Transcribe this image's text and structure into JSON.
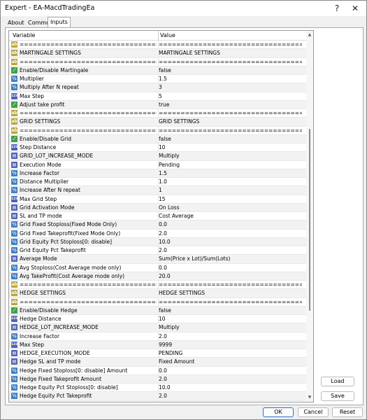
{
  "window": {
    "title": "Expert - EA-MacdTradingEa"
  },
  "titlebar": {
    "help_icon": "?",
    "close_icon": "✕"
  },
  "tabs": [
    {
      "label": "About"
    },
    {
      "label": "Common"
    },
    {
      "label": "Inputs"
    }
  ],
  "active_tab": "Inputs",
  "grid": {
    "col_variable": "Variable",
    "col_value": "Value",
    "rows": [
      {
        "icon": "ab",
        "name": "=================================================",
        "value": "================================================="
      },
      {
        "icon": "ab",
        "name": "MARTINGALE SETTINGS",
        "value": "MARTINGALE SETTINGS"
      },
      {
        "icon": "ab",
        "name": "=================================================",
        "value": "================================================="
      },
      {
        "icon": "bool",
        "name": "Enable/Disable Martingale",
        "value": "false"
      },
      {
        "icon": "val",
        "name": "Multiplier",
        "value": "1.5"
      },
      {
        "icon": "val",
        "name": "Multiply After N repeat",
        "value": "3"
      },
      {
        "icon": "int",
        "name": "Max Step",
        "value": "5"
      },
      {
        "icon": "bool",
        "name": "Adjust take profit",
        "value": "true"
      },
      {
        "icon": "ab",
        "name": "=================================================",
        "value": "================================================="
      },
      {
        "icon": "ab",
        "name": "GRID SETTINGS",
        "value": "GRID SETTINGS"
      },
      {
        "icon": "ab",
        "name": "=================================================",
        "value": "================================================="
      },
      {
        "icon": "bool",
        "name": "Enable/Disable Grid",
        "value": "false"
      },
      {
        "icon": "int",
        "name": "Step Distance",
        "value": "10"
      },
      {
        "icon": "en",
        "name": "GRID_LOT_INCREASE_MODE",
        "value": "Multiply"
      },
      {
        "icon": "en",
        "name": "Execution Mode",
        "value": "Pending"
      },
      {
        "icon": "val",
        "name": "Increase Factor",
        "value": "1.5"
      },
      {
        "icon": "val",
        "name": "Distance Multiplier",
        "value": "1.0"
      },
      {
        "icon": "val",
        "name": "Increase After N repeat",
        "value": "1"
      },
      {
        "icon": "int",
        "name": "Max Grid Step",
        "value": "15"
      },
      {
        "icon": "en",
        "name": "Grid Activation Mode",
        "value": "On Loss"
      },
      {
        "icon": "en",
        "name": "SL and TP mode",
        "value": "Cost Average"
      },
      {
        "icon": "val",
        "name": "Grid Fixed Stoploss(Fixed Mode Only)",
        "value": "0.0"
      },
      {
        "icon": "val",
        "name": "Grid Fixed Takeprofit(Fixed Mode Only)",
        "value": "2.0"
      },
      {
        "icon": "val",
        "name": "Grid Equity Pct Stoploss[0: disable]",
        "value": "10.0"
      },
      {
        "icon": "val",
        "name": "Grid Equity Pct Takeprofit",
        "value": "2.0"
      },
      {
        "icon": "en",
        "name": "Average Mode",
        "value": "Sum(Price x Lot)/Sum(Lots)"
      },
      {
        "icon": "val",
        "name": "Avg Stoploss(Cost Average mode only)",
        "value": "0.0"
      },
      {
        "icon": "val",
        "name": "Avg TakeProfit(Cost Average mode only)",
        "value": "20.0"
      },
      {
        "icon": "ab",
        "name": "=================================================",
        "value": "================================================="
      },
      {
        "icon": "ab",
        "name": "HEDGE SETTINGS",
        "value": "HEDGE SETTINGS"
      },
      {
        "icon": "ab",
        "name": "=================================================",
        "value": "================================================="
      },
      {
        "icon": "bool",
        "name": "Enable/Disable Hedge",
        "value": "false"
      },
      {
        "icon": "int",
        "name": "Hedge Distance",
        "value": "10"
      },
      {
        "icon": "en",
        "name": "HEDGE_LOT_INCREASE_MODE",
        "value": "Multiply"
      },
      {
        "icon": "val",
        "name": "Increase Factor",
        "value": "2.0"
      },
      {
        "icon": "int",
        "name": "Max Step",
        "value": "9999"
      },
      {
        "icon": "en",
        "name": "HEDGE_EXECUTION_MODE",
        "value": "PENDING"
      },
      {
        "icon": "en",
        "name": "Hedge SL and TP mode",
        "value": "Fixed Amount"
      },
      {
        "icon": "val",
        "name": "Hedge Fixed Stoploss[0: disable] Amount",
        "value": "0.0"
      },
      {
        "icon": "val",
        "name": "Hedge Fixed Takeprofit Amount",
        "value": "2.0"
      },
      {
        "icon": "val",
        "name": "Hedge Equity Pct Stoploss[0: disable]",
        "value": "10.0"
      },
      {
        "icon": "val",
        "name": "Hedge Equity Pct Takeprofit",
        "value": "2.0"
      }
    ]
  },
  "side_buttons": {
    "load": "Load",
    "save": "Save"
  },
  "footer": {
    "ok": "OK",
    "cancel": "Cancel",
    "reset": "Reset"
  },
  "icon_glyphs": {
    "ab": "ab",
    "val": "½",
    "bool": "⟋",
    "int": "123",
    "en": "▤"
  }
}
